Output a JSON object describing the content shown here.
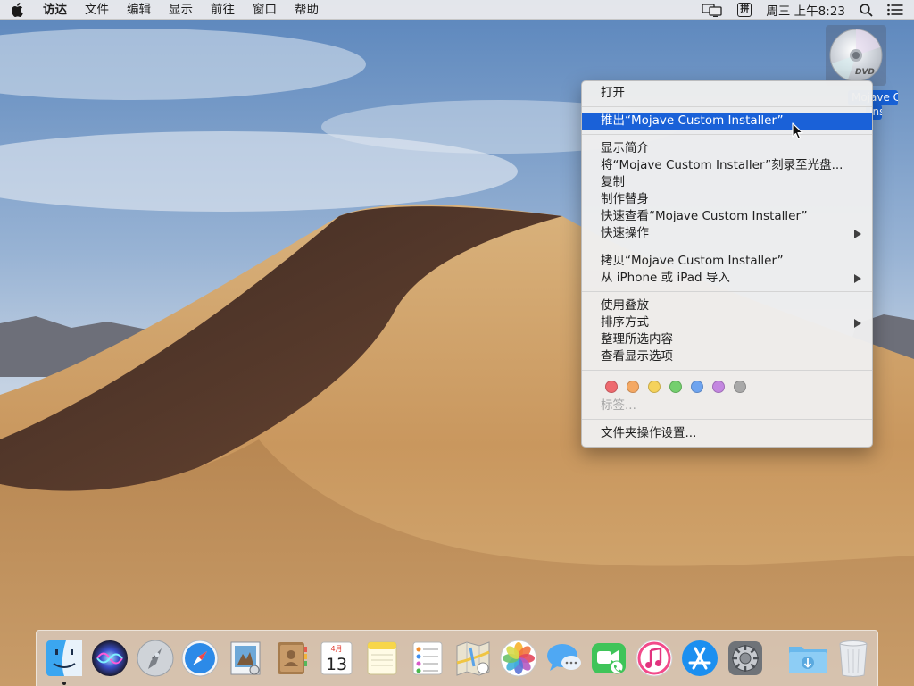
{
  "menubar": {
    "app_name": "访达",
    "menus": [
      "文件",
      "编辑",
      "显示",
      "前往",
      "窗口",
      "帮助"
    ],
    "ime_label": "拼",
    "clock": "周三 上午8:23"
  },
  "desktop": {
    "dvd_label_line1": "Mojave Custom",
    "dvd_label_line2": "Installer",
    "dvd_badge": "DVD"
  },
  "context_menu": {
    "open": "打开",
    "eject": "推出“Mojave Custom Installer”",
    "get_info": "显示简介",
    "burn": "将“Mojave Custom Installer”刻录至光盘...",
    "duplicate": "复制",
    "make_alias": "制作替身",
    "quick_look": "快速查看“Mojave Custom Installer”",
    "quick_actions": "快速操作",
    "copy": "拷贝“Mojave Custom Installer”",
    "import_iphone": "从 iPhone 或 iPad 导入",
    "use_stacks": "使用叠放",
    "sort_by": "排序方式",
    "clean_up_selection": "整理所选内容",
    "show_view_options": "查看显示选项",
    "tag_colors": [
      "#ee6a6f",
      "#f4a863",
      "#f5d25b",
      "#74cf6e",
      "#6ea4ef",
      "#c387e0",
      "#a9a9a9"
    ],
    "tags_label": "标签...",
    "folder_actions": "文件夹操作设置..."
  },
  "dock": {
    "calendar_month": "4月",
    "calendar_day": "13"
  }
}
